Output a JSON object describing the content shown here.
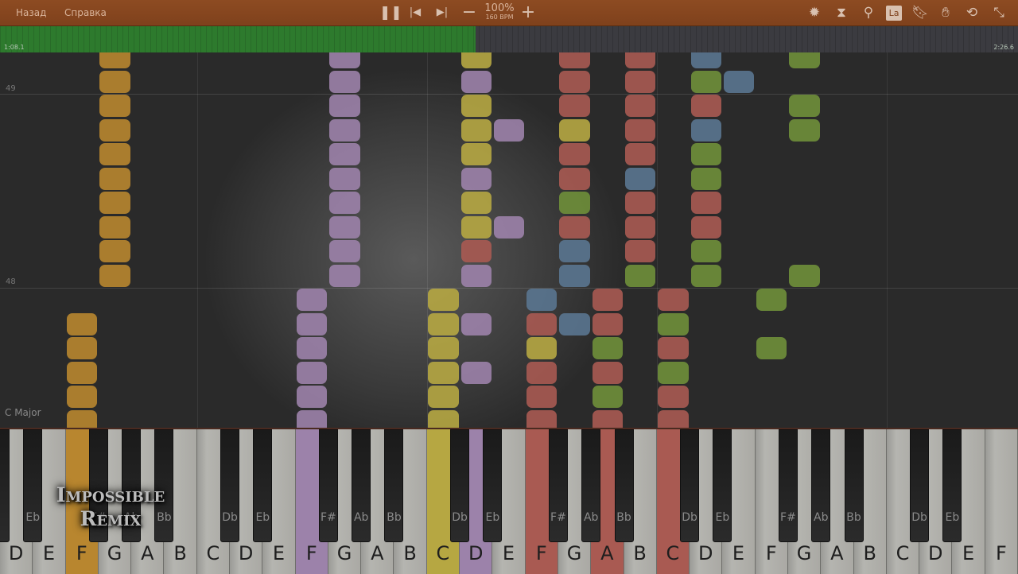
{
  "menu": {
    "back": "Назад",
    "help": "Справка"
  },
  "playback": {
    "speed": "100%",
    "tempo": "160 BPM",
    "progress_percent": 46.7
  },
  "toolbar_icons": [
    "pause-icon",
    "skip-back-icon",
    "skip-forward-icon",
    "minus-icon",
    "plus-icon",
    "gear-icon",
    "metronome-icon",
    "magnifier-icon",
    "label-icon",
    "bookmark-icon",
    "hand-icon",
    "loop-icon",
    "exit-fullscreen-icon"
  ],
  "toolbar": {
    "label_button": "La"
  },
  "timeline": {
    "current": "1:08.1",
    "total": "2:26.6"
  },
  "roll": {
    "measure_upper": "49",
    "measure_lower": "48",
    "key_signature": "C Major"
  },
  "keyboard": {
    "white_keys": [
      "D",
      "E",
      "F",
      "G",
      "A",
      "B",
      "C",
      "D",
      "E",
      "F",
      "G",
      "A",
      "B",
      "C",
      "D",
      "E",
      "F",
      "G",
      "A",
      "B",
      "C",
      "D",
      "E",
      "F",
      "G",
      "A",
      "B",
      "C",
      "D",
      "E",
      "F"
    ],
    "black_names": {
      "C": "Db",
      "D": "Eb",
      "F": "F#",
      "G": "Ab",
      "A": "Bb"
    }
  },
  "overlay": {
    "line1": "Impossible",
    "line2": "Remix"
  },
  "colors": {
    "orange": "#b8862f",
    "purple": "#9c82aa",
    "yellow": "#b6a742",
    "red": "#a95a52",
    "green": "#6f8f3a",
    "blue": "#5a7590",
    "bar": "#8a4820",
    "progress": "#2d7a2d"
  }
}
